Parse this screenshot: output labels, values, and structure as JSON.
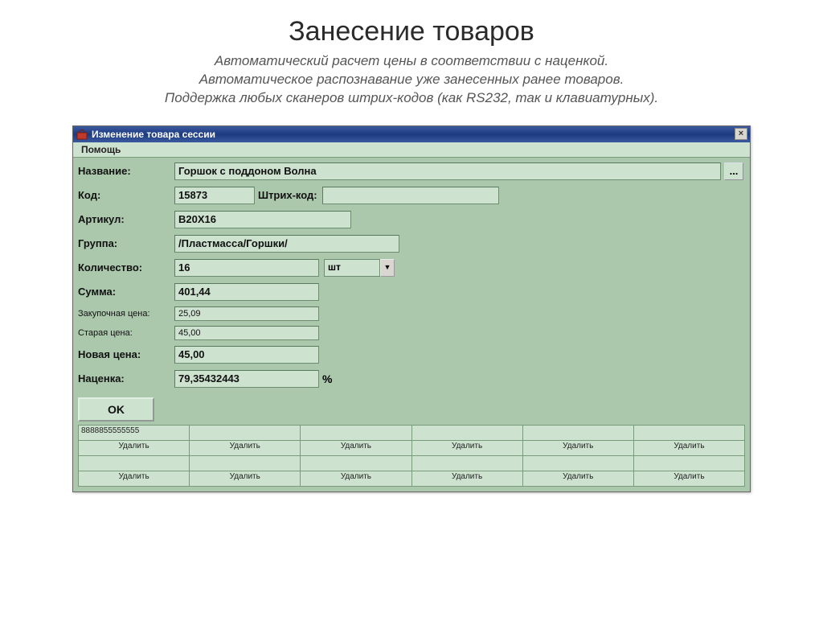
{
  "slide": {
    "title": "Занесение товаров",
    "sub1": "Автоматический расчет цены в соответствии с наценкой.",
    "sub2": "Автоматическое распознавание уже занесенных ранее товаров.",
    "sub3": "Поддержка любых сканеров штрих-кодов (как RS232, так и клавиатурных)."
  },
  "window": {
    "title": "Изменение товара сессии",
    "close": "×",
    "menu": {
      "help": "Помощь"
    }
  },
  "form": {
    "name_label": "Название:",
    "name_value": "Горшок с поддоном Волна",
    "dots": "...",
    "code_label": "Код:",
    "code_value": "15873",
    "barcode_label": "Штрих-код:",
    "barcode_value": "",
    "sku_label": "Артикул:",
    "sku_value": "В20Х16",
    "group_label": "Группа:",
    "group_value": "/Пластмасса/Горшки/",
    "qty_label": "Количество:",
    "qty_value": "16",
    "unit_value": "шт",
    "sum_label": "Сумма:",
    "sum_value": "401,44",
    "purchase_label": "Закупочная цена:",
    "purchase_value": "25,09",
    "oldprice_label": "Старая цена:",
    "oldprice_value": "45,00",
    "newprice_label": "Новая цена:",
    "newprice_value": "45,00",
    "markup_label": "Наценка:",
    "markup_value": "79,35432443",
    "markup_unit": "%",
    "ok": "OK"
  },
  "grid": {
    "row1": [
      "8888855555555",
      "",
      "",
      "",
      "",
      ""
    ],
    "delete_label": "Удалить",
    "row2": [
      "",
      "",
      "",
      "",
      "",
      ""
    ]
  }
}
